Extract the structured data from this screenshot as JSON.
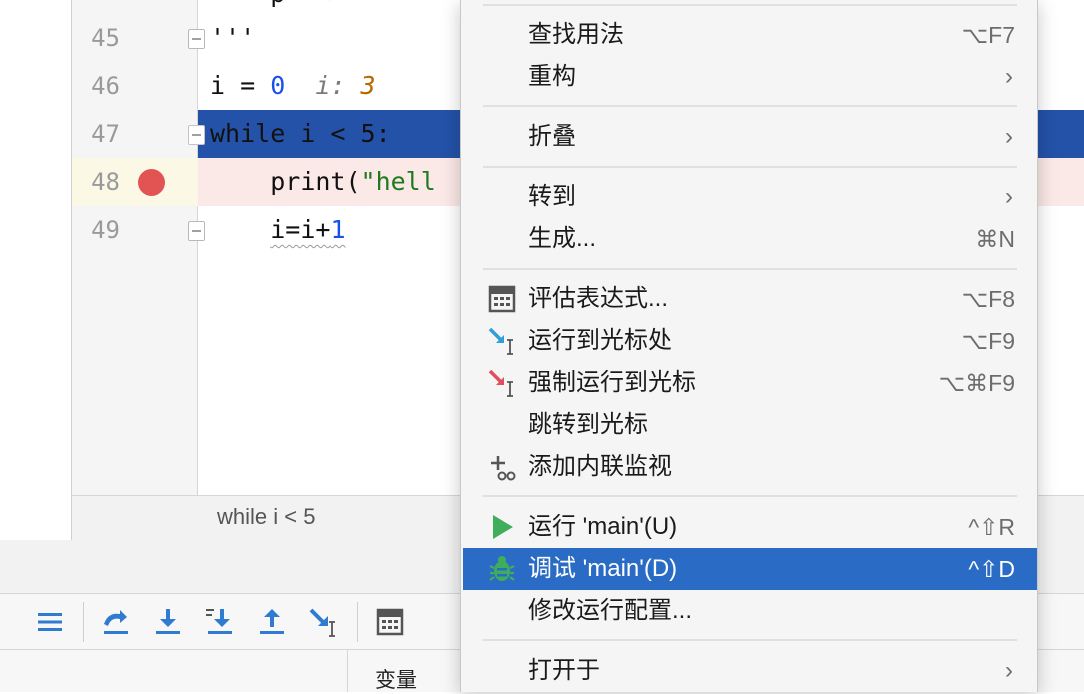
{
  "editor": {
    "lines": [
      {
        "num": "45",
        "text": "'''"
      },
      {
        "num": "46",
        "code": "i = ",
        "num_val": "0",
        "inline_label": "i: ",
        "inline_val": "3"
      },
      {
        "num": "47",
        "text": "while i < 5:"
      },
      {
        "num": "48",
        "fn": "print(",
        "str": "\"hell"
      },
      {
        "num": "49",
        "pre": "i=i+",
        "val": "1"
      }
    ],
    "breadcrumb": "while i < 5"
  },
  "debug": {
    "variables_tab": "变量",
    "toolbar_icons": [
      "frames-icon",
      "step-over-icon",
      "step-into-icon",
      "step-into-my-code-icon",
      "step-out-icon",
      "run-to-cursor-icon",
      "evaluate-icon"
    ]
  },
  "menu": {
    "items": {
      "find_usages": {
        "label": "查找用法",
        "shortcut": "⌥F7"
      },
      "refactor": {
        "label": "重构",
        "arrow": "›"
      },
      "fold": {
        "label": "折叠",
        "arrow": "›"
      },
      "goto": {
        "label": "转到",
        "arrow": "›"
      },
      "generate": {
        "label": "生成...",
        "shortcut": "⌘N"
      },
      "evaluate": {
        "label": "评估表达式...",
        "shortcut": "⌥F8"
      },
      "run_to_cursor": {
        "label": "运行到光标处",
        "shortcut": "⌥F9"
      },
      "force_run_to_cursor": {
        "label": "强制运行到光标",
        "shortcut": "⌥⌘F9"
      },
      "jump_to_cursor": {
        "label": "跳转到光标"
      },
      "add_inline_watch": {
        "label": "添加内联监视"
      },
      "run_main": {
        "label": "运行 'main'(U)",
        "shortcut": "^⇧R"
      },
      "debug_main": {
        "label": "调试 'main'(D)",
        "shortcut": "^⇧D"
      },
      "modify_run_config": {
        "label": "修改运行配置..."
      },
      "open_in": {
        "label": "打开于",
        "arrow": "›"
      }
    },
    "selected": "debug_main"
  },
  "colors": {
    "exec_line": "#2452a8",
    "menu_selected": "#2a6bc5",
    "breakpoint": "#e25353",
    "run_green": "#3fae5a",
    "toolbar_blue": "#2f7bd1"
  }
}
